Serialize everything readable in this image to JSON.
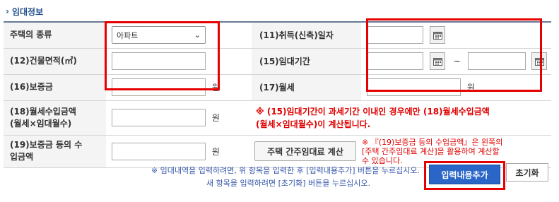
{
  "section": {
    "title": "임대정보",
    "chevron_icon": "chevron-right-icon"
  },
  "rows": {
    "house_type": {
      "label": "주택의 종류",
      "selected": "아파트"
    },
    "acquire_date": {
      "label": "(11)취득(신축)일자"
    },
    "building_area": {
      "label": "(12)건물면적(㎡)"
    },
    "lease_period": {
      "label": "(15)임대기간",
      "separator": "~"
    },
    "deposit": {
      "label": "(16)보증금",
      "unit": "원"
    },
    "monthly_rent": {
      "label": "(17)월세",
      "unit": "원"
    },
    "rent_income": {
      "label_line1": "(18)월세수입금액",
      "label_line2": "(월세×임대월수)",
      "unit": "원",
      "note_line1": "※ (15)임대기간이 과세기간 이내인 경우에만 (18)월세수입금액",
      "note_line2": "(월세×임대월수)이 계산됩니다."
    },
    "deposit_income": {
      "label_line1": "(19)보증금 등의 수",
      "label_line2": "입금액",
      "unit": "원",
      "calc_button": "주택 간주임대료 계산",
      "note_line1": "※ 『(19)보증금 등의 수입금액』은 왼쪽의",
      "note_line2": "[주택 간주임대료 계산]을 활용하여 계산할",
      "note_line3": "수 있습니다."
    }
  },
  "footer": {
    "note_line1": "※ 임대내역을 입력하려면, 위 항목을 입력한 후 [입력내용추가] 버튼을 누르십시오.",
    "note_line2": "새 항목을 입력하려면 [초기화] 버튼을 누르십시오.",
    "add_button": "입력내용추가",
    "reset_button": "초기화"
  },
  "colors": {
    "highlight": "#e60000",
    "primary_button": "#2a66c8",
    "note_red": "#e00000",
    "note_blue": "#3355aa"
  }
}
